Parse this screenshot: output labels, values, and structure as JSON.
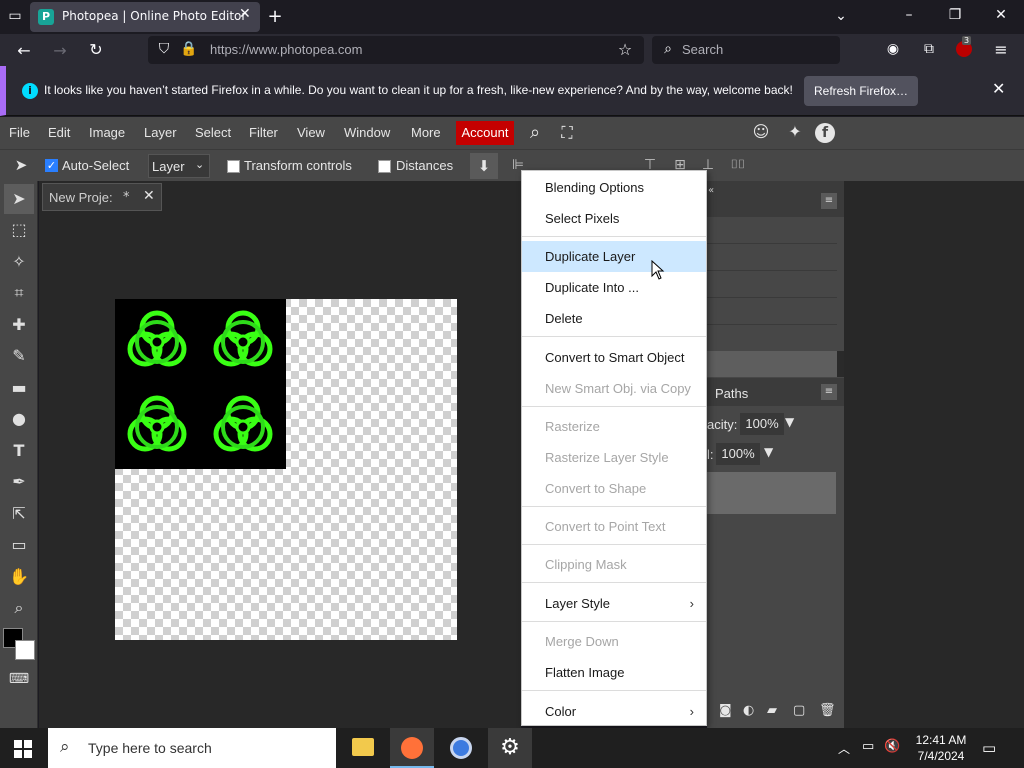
{
  "browser": {
    "tab_title": "Photopea | Online Photo Editor",
    "tab_favicon": "P",
    "url": "https://www.photopea.com",
    "search_placeholder": "Search",
    "extension_badge": "3",
    "notification": {
      "message": "It looks like you haven’t started Firefox in a while. Do you want to clean it up for a fresh, like-new experience? And by the way, welcome back!",
      "button": "Refresh Firefox…"
    }
  },
  "photopea": {
    "menu": [
      "File",
      "Edit",
      "Image",
      "Layer",
      "Select",
      "Filter",
      "View",
      "Window",
      "More"
    ],
    "account_label": "Account",
    "options": {
      "auto_select_label": "Auto-Select",
      "layer_select_value": "Layer",
      "transform_label": "Transform controls",
      "distances_label": "Distances"
    },
    "document_tab": "New Proje:",
    "document_tab_modified": "*",
    "panels": {
      "paths_label": "Paths",
      "opacity_label": "acity:",
      "opacity_value": "100%",
      "fill_label": "l:",
      "fill_value": "100%"
    }
  },
  "context_menu": {
    "items": [
      {
        "label": "Blending Options",
        "enabled": true
      },
      {
        "label": "Select Pixels",
        "enabled": true
      },
      {
        "label": "Duplicate Layer",
        "enabled": true,
        "highlighted": true
      },
      {
        "label": "Duplicate Into ...",
        "enabled": true
      },
      {
        "label": "Delete",
        "enabled": true
      },
      {
        "label": "Convert to Smart Object",
        "enabled": true
      },
      {
        "label": "New Smart Obj. via Copy",
        "enabled": false
      },
      {
        "label": "Rasterize",
        "enabled": false
      },
      {
        "label": "Rasterize Layer Style",
        "enabled": false
      },
      {
        "label": "Convert to Shape",
        "enabled": false
      },
      {
        "label": "Convert to Point Text",
        "enabled": false
      },
      {
        "label": "Clipping Mask",
        "enabled": false
      },
      {
        "label": "Layer Style",
        "enabled": true,
        "submenu": true
      },
      {
        "label": "Merge Down",
        "enabled": false
      },
      {
        "label": "Flatten Image",
        "enabled": true
      },
      {
        "label": "Color",
        "enabled": true,
        "submenu": true
      }
    ]
  },
  "taskbar": {
    "search_placeholder": "Type here to search",
    "time": "12:41 AM",
    "date": "7/4/2024"
  },
  "colors": {
    "accent_account": "#c40000",
    "highlight": "#cde8ff",
    "biohazard_green": "#39ff14",
    "notification_stripe": "#a96cf7"
  }
}
